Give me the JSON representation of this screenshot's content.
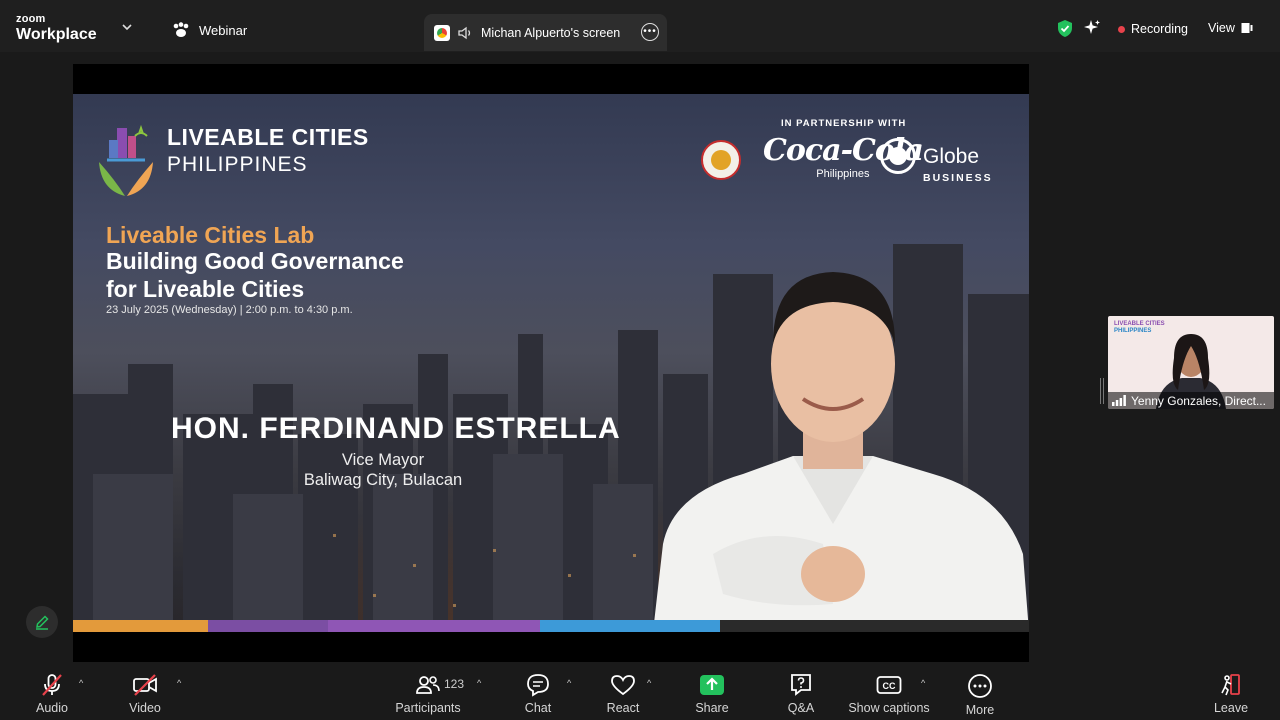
{
  "app": {
    "brand_small": "zoom",
    "brand_big": "Workplace",
    "mode_label": "Webinar"
  },
  "tab": {
    "title": "Michan Alpuerto's screen"
  },
  "status": {
    "recording_label": "Recording",
    "view_label": "View"
  },
  "slide": {
    "logo_line1": "LIVEABLE CITIES",
    "logo_line2": "PHILIPPINES",
    "partnership_label": "IN PARTNERSHIP WITH",
    "sponsor1_name": "Coca-Cola",
    "sponsor1_sub": "Philippines",
    "sponsor2_name": "Globe",
    "sponsor2_sub": "BUSINESS",
    "event_series": "Liveable Cities Lab",
    "event_title_line1": "Building Good Governance",
    "event_title_line2": "for Liveable Cities",
    "event_date": "23 July 2025 (Wednesday) | 2:00 p.m. to 4:30 p.m.",
    "speaker_name": "HON. FERDINAND ESTRELLA",
    "speaker_role": "Vice Mayor",
    "speaker_location": "Baliwag City, Bulacan",
    "strip_colors": [
      "#e39a3b",
      "#7b4ea3",
      "#8f56b5",
      "#3d9ad8",
      "#2a2a2a"
    ]
  },
  "participant_thumb": {
    "logo_line1": "LIVEABLE CITIES",
    "logo_line2": "PHILIPPINES",
    "name": "Yenny Gonzales, Direct..."
  },
  "toolbar": {
    "audio": "Audio",
    "video": "Video",
    "participants": "Participants",
    "participants_count": "123",
    "chat": "Chat",
    "react": "React",
    "share": "Share",
    "qa": "Q&A",
    "captions": "Show captions",
    "more": "More",
    "leave": "Leave"
  },
  "colors": {
    "accent_green": "#23c15d",
    "recording_red": "#e8424b",
    "leave_red": "#e8424b",
    "lab_orange": "#f0a554"
  },
  "icons": {
    "chevron": "chevron-down-icon",
    "paw": "webinar-icon",
    "speaker": "speaker-icon",
    "shield": "shield-check-icon",
    "sparkle": "ai-sparkle-icon",
    "view": "view-layout-icon",
    "mic": "mic-muted-icon",
    "camera": "video-off-icon",
    "people": "participants-icon",
    "chat": "chat-icon",
    "heart": "react-heart-icon",
    "share": "share-arrow-icon",
    "qa": "qa-icon",
    "cc": "closed-captions-icon",
    "more": "more-dots-icon",
    "leave": "leave-icon",
    "pencil": "annotate-pencil-icon"
  }
}
